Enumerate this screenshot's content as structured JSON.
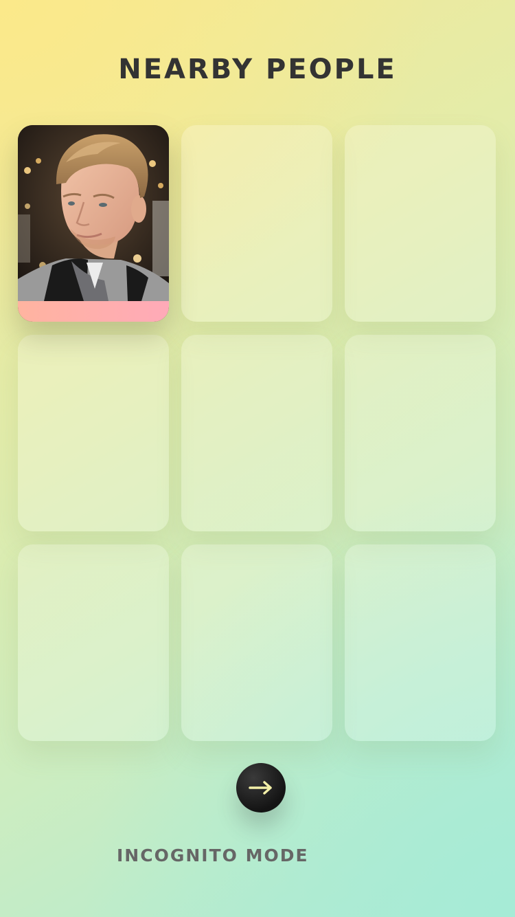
{
  "header": {
    "title": "NEARBY PEOPLE"
  },
  "people": [
    {
      "slot": 1,
      "filled": true,
      "avatar": "person-photo",
      "accent": "#ffb0ad"
    },
    {
      "slot": 2,
      "filled": false
    },
    {
      "slot": 3,
      "filled": false
    },
    {
      "slot": 4,
      "filled": false
    },
    {
      "slot": 5,
      "filled": false
    },
    {
      "slot": 6,
      "filled": false
    },
    {
      "slot": 7,
      "filled": false
    },
    {
      "slot": 8,
      "filled": false
    },
    {
      "slot": 9,
      "filled": false
    }
  ],
  "actions": {
    "next_icon": "arrow-right-icon",
    "next_icon_color": "#f3f0a8",
    "incognito_label": "INCOGNITO MODE"
  },
  "colors": {
    "title": "#333333",
    "incognito": "#666666",
    "button": "#1a1a1a"
  }
}
